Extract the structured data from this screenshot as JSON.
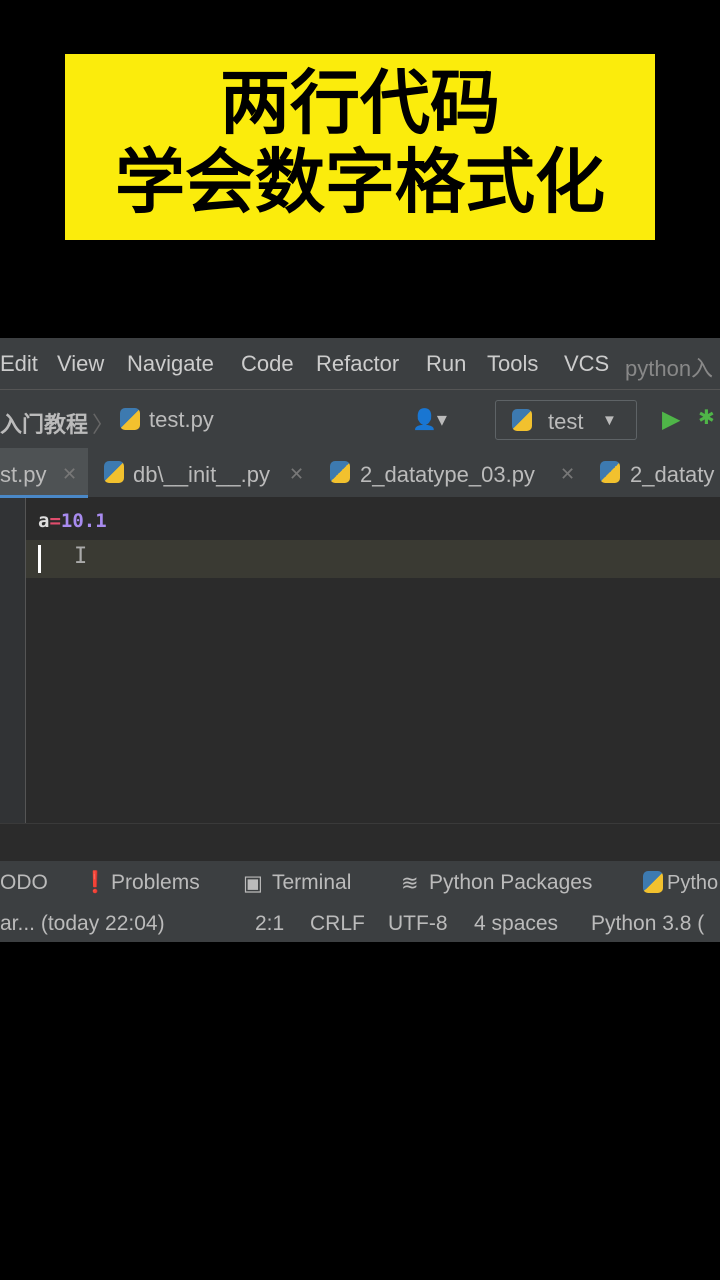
{
  "banner": {
    "line1": "两行代码",
    "line2": "学会数字格式化"
  },
  "menu": [
    "Edit",
    "View",
    "Navigate",
    "Code",
    "Refactor",
    "Run",
    "Tools",
    "VCS"
  ],
  "menu_project": "python入",
  "nav": {
    "breadcrumb": "入门教程",
    "file": "test.py",
    "run_config": "test"
  },
  "tabs": [
    "st.py",
    "db\\__init__.py",
    "2_datatype_03.py",
    "2_dataty"
  ],
  "code": {
    "var": "a",
    "op": "=",
    "num": "10.1"
  },
  "toolwindows": [
    "ODO",
    "Problems",
    "Terminal",
    "Python Packages",
    "Pytho"
  ],
  "status": {
    "vcs": "ar... (today 22:04)",
    "pos": "2:1",
    "eol": "CRLF",
    "enc": "UTF-8",
    "indent": "4 spaces",
    "interp": "Python 3.8 ("
  },
  "colors": {
    "banner": "#fbec0c",
    "number": "#a88bef",
    "operator": "#e04d6d"
  }
}
